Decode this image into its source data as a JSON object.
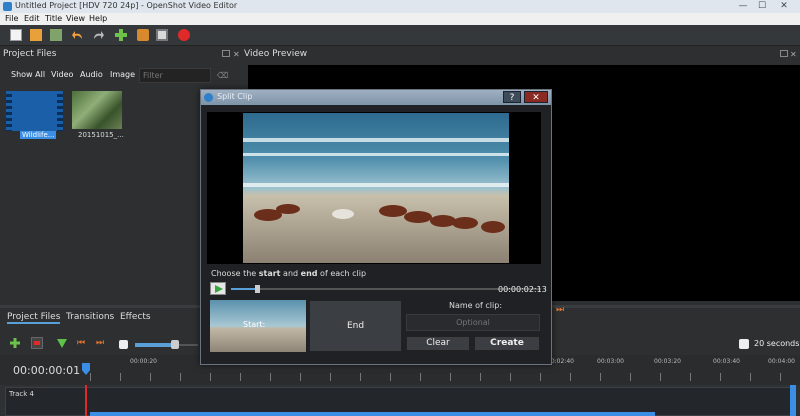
{
  "window": {
    "title": "Untitled Project [HDV 720 24p] - OpenShot Video Editor",
    "minimize": "—",
    "maximize": "☐",
    "close": "✕"
  },
  "menu": [
    "File",
    "Edit",
    "Title",
    "View",
    "Help"
  ],
  "project_files": {
    "title": "Project Files",
    "filters": [
      "Show All",
      "Video",
      "Audio",
      "Image"
    ],
    "filter_placeholder": "Filter",
    "files": [
      {
        "name": "Wildlife...",
        "selected": true
      },
      {
        "name": "20151015_...",
        "selected": false
      }
    ]
  },
  "video_preview": {
    "title": "Video Preview"
  },
  "dialog": {
    "title": "Split Clip",
    "help": "?",
    "close": "✕",
    "instruction_prefix": "Choose the ",
    "instruction_start": "start",
    "instruction_mid": " and ",
    "instruction_end": "end",
    "instruction_suffix": " of each clip",
    "timecode": "00:00:02:13",
    "start_label": "Start:",
    "end_label": "End",
    "name_label": "Name of clip:",
    "name_placeholder": "Optional",
    "clear": "Clear",
    "create": "Create"
  },
  "bottom_tabs": [
    "Project Files",
    "Transitions",
    "Effects"
  ],
  "timeline": {
    "timecode": "00:00:00:01",
    "zoom": "20 seconds",
    "ruler": [
      "00:00:20",
      "00:02:40",
      "00:03:00",
      "00:03:20",
      "00:03:40",
      "00:04:00"
    ],
    "track_name": "Track 4"
  }
}
